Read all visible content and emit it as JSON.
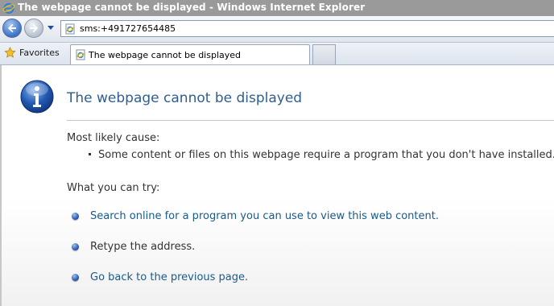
{
  "window": {
    "title": "The webpage cannot be displayed - Windows Internet Explorer"
  },
  "navigation": {
    "address_url": "sms:+491727654485"
  },
  "favorites_bar": {
    "favorites_label": "Favorites",
    "tab_label": "The webpage cannot be displayed"
  },
  "error_page": {
    "title": "The webpage cannot be displayed",
    "cause_heading": "Most likely cause:",
    "cause_items": [
      "Some content or files on this webpage require a program that you don't have installed."
    ],
    "try_heading": "What you can try:",
    "try_items": [
      {
        "label": "Search online for a program you can use to view this web content.",
        "is_link": true
      },
      {
        "label": "Retype the address.",
        "is_link": false
      },
      {
        "label": "Go back to the previous page.",
        "is_link": true
      }
    ]
  },
  "colors": {
    "titlebar": "#9a9a9a",
    "title_text": "#2e5e91",
    "link": "#1a5a8a",
    "body_text": "#333333"
  }
}
